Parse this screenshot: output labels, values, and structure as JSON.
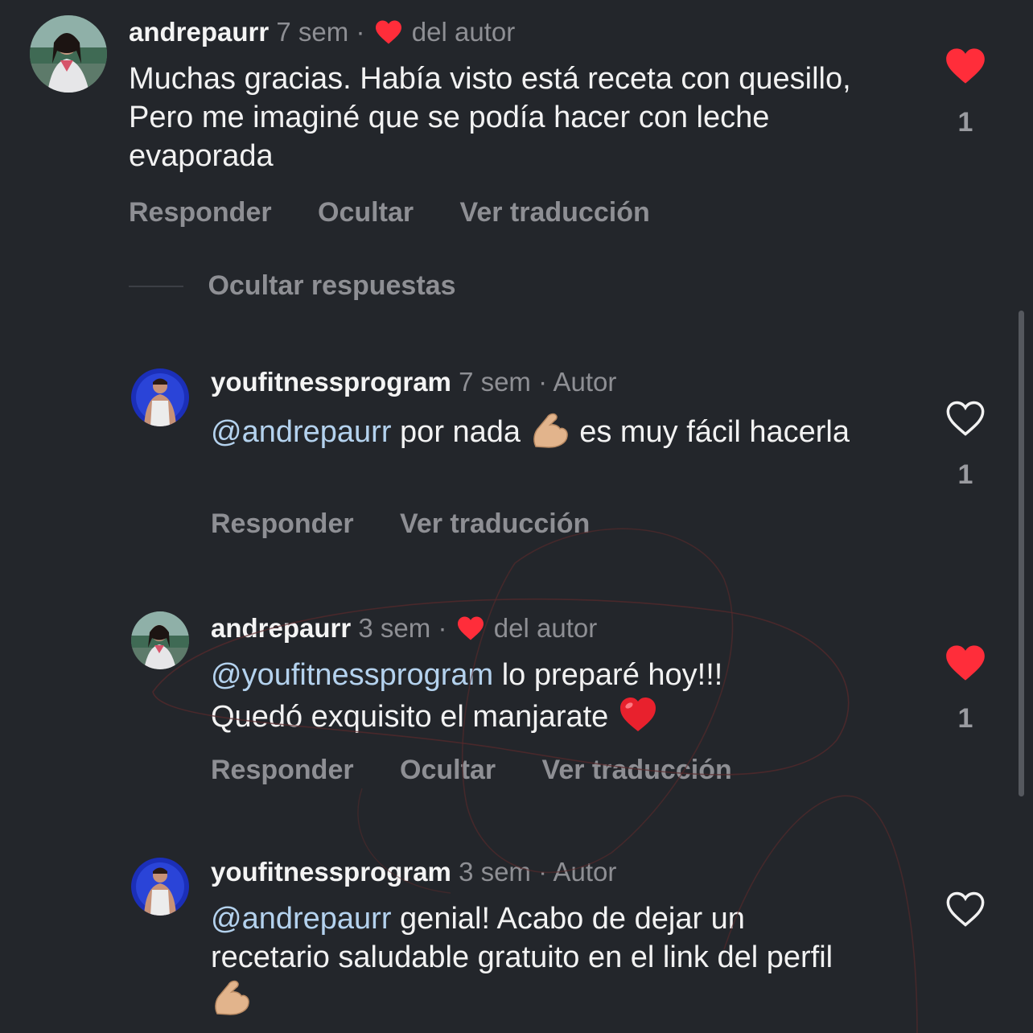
{
  "comments": [
    {
      "username": "andrepaurr",
      "time": "7 sem",
      "separator": "·",
      "badge": "del autor",
      "badge_icon": "red-heart-icon",
      "text": "Muchas gracias. Había visto está receta con quesillo, Pero me imaginé que se podía hacer con leche evaporada",
      "actions": {
        "reply": "Responder",
        "hide": "Ocultar",
        "translate": "Ver traducción"
      },
      "likes": "1",
      "liked": true
    },
    {
      "username": "youfitnessprogram",
      "time": "7 sem",
      "separator": "·",
      "badge": "Autor",
      "mention": "@andrepaurr",
      "text_a": "por nada",
      "emoji": "flexed-biceps-emoji",
      "text_b": "es muy fácil hacerla",
      "actions": {
        "reply": "Responder",
        "translate": "Ver traducción"
      },
      "likes": "1",
      "liked": false
    },
    {
      "username": "andrepaurr",
      "time": "3 sem",
      "separator": "·",
      "badge": "del autor",
      "badge_icon": "red-heart-icon",
      "mention": "@youfitnessprogram",
      "text_a": "lo preparé hoy!!! Quedó exquisito el manjarate",
      "emoji": "red-heart-emoji",
      "actions": {
        "reply": "Responder",
        "hide": "Ocultar",
        "translate": "Ver traducción"
      },
      "likes": "1",
      "liked": true
    },
    {
      "username": "youfitnessprogram",
      "time": "3 sem",
      "separator": "·",
      "badge": "Autor",
      "mention": "@andrepaurr",
      "text_a": "genial! Acabo de dejar un recetario saludable gratuito en el link del perfil",
      "emoji": "flexed-biceps-emoji",
      "liked": false
    }
  ],
  "hide_replies_label": "Ocultar respuestas",
  "colors": {
    "background": "#23262b",
    "mention": "#b4d2ee",
    "like_red": "#ff2d3a",
    "muted_text": "#8e8f94"
  }
}
